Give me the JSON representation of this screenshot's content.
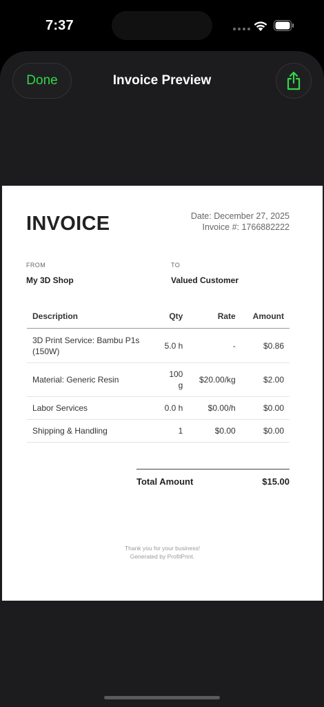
{
  "status": {
    "time": "7:37"
  },
  "nav": {
    "done_label": "Done",
    "title": "Invoice Preview"
  },
  "colors": {
    "accent": "#32d74b",
    "sheet_bg": "#1c1c1e"
  },
  "icons": {
    "share": "share-icon",
    "wifi": "wifi-icon",
    "battery": "battery-icon"
  },
  "invoice": {
    "title": "INVOICE",
    "date": "Date: December 27, 2025",
    "number": "Invoice #: 1766882222",
    "from_label": "FROM",
    "from_name": "My 3D Shop",
    "to_label": "TO",
    "to_name": "Valued Customer",
    "columns": {
      "description": "Description",
      "qty": "Qty",
      "rate": "Rate",
      "amount": "Amount"
    },
    "items": [
      {
        "description": "3D Print Service: Bambu P1s (150W)",
        "qty": "5.0 h",
        "rate": "-",
        "amount": "$0.86"
      },
      {
        "description": "Material: Generic Resin",
        "qty": "100 g",
        "rate": "$20.00/kg",
        "amount": "$2.00"
      },
      {
        "description": "Labor Services",
        "qty": "0.0 h",
        "rate": "$0.00/h",
        "amount": "$0.00"
      },
      {
        "description": "Shipping & Handling",
        "qty": "1",
        "rate": "$0.00",
        "amount": "$0.00"
      }
    ],
    "total_label": "Total Amount",
    "total_value": "$15.00",
    "footer_line1": "Thank you for your business!",
    "footer_line2": "Generated by ProfitPrint."
  }
}
